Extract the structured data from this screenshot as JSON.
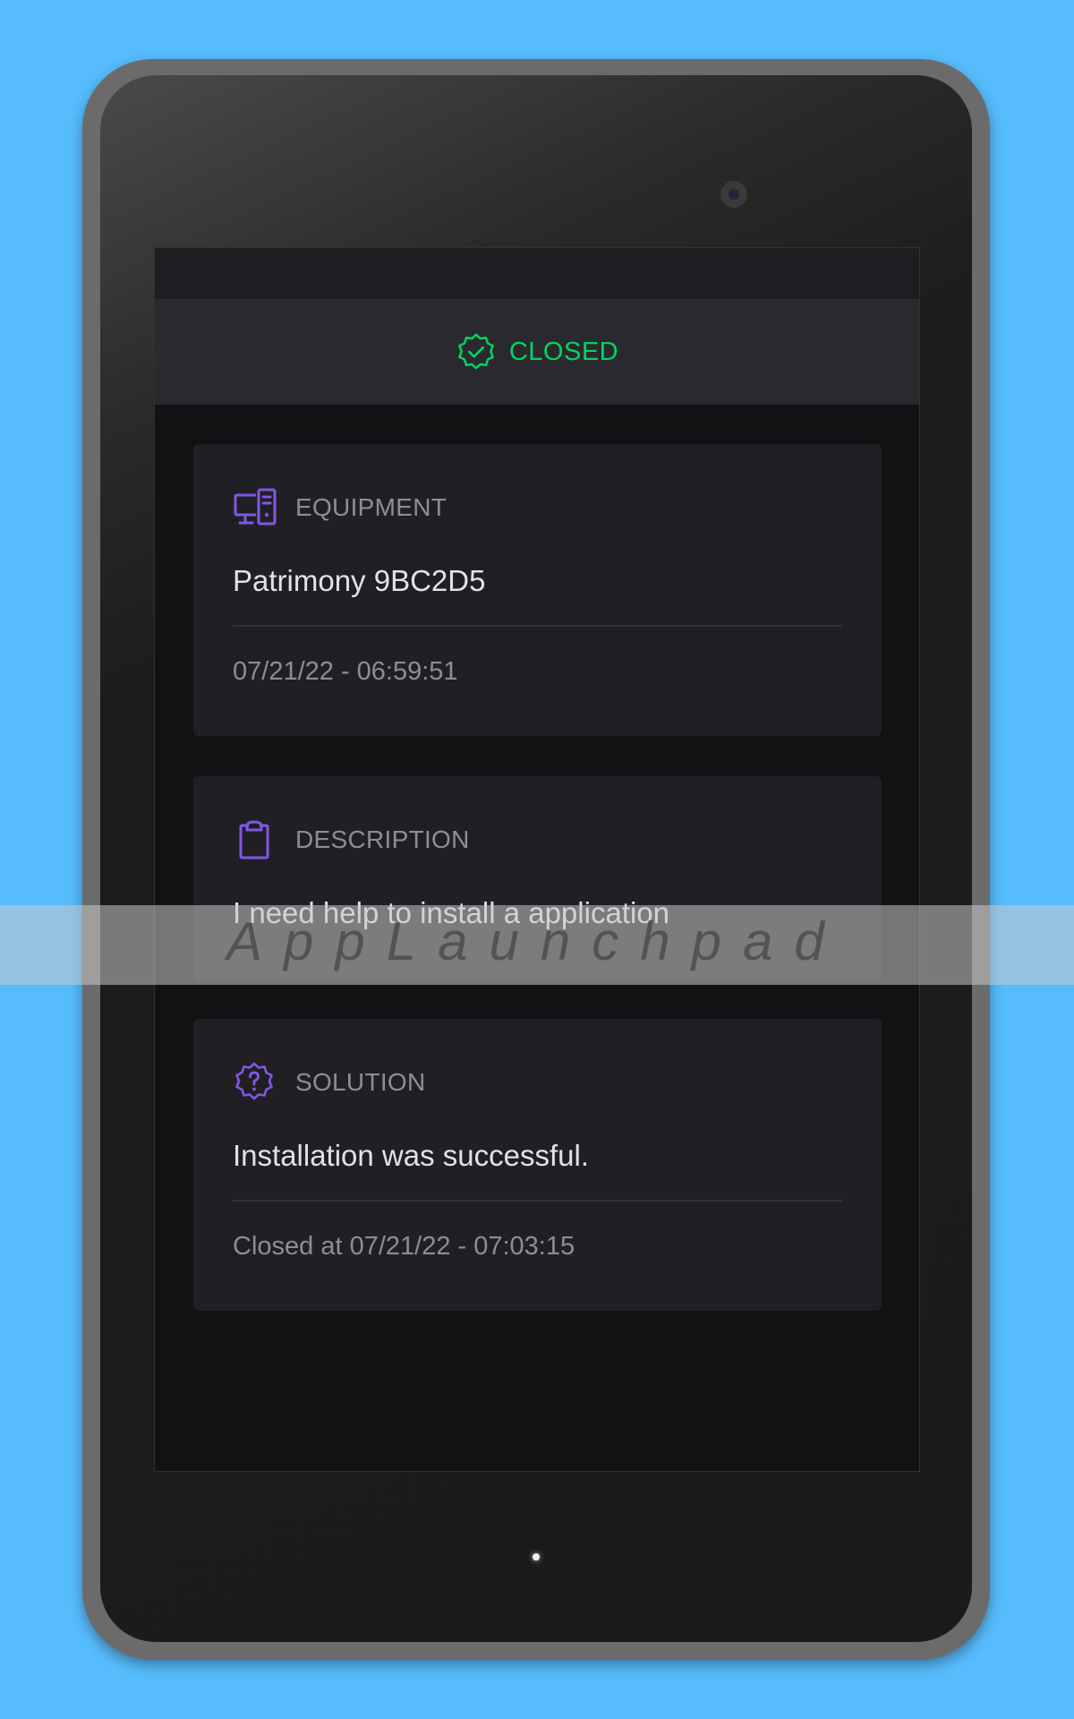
{
  "header": {
    "status": "CLOSED",
    "icon": "seal-check-icon"
  },
  "cards": {
    "equipment": {
      "icon": "desktop-tower-icon",
      "title": "EQUIPMENT",
      "value": "Patrimony 9BC2D5",
      "footer": "07/21/22 - 06:59:51"
    },
    "description": {
      "icon": "clipboard-icon",
      "title": "DESCRIPTION",
      "value": "I need help to install a application"
    },
    "solution": {
      "icon": "seal-question-icon",
      "title": "SOLUTION",
      "value": "Installation was successful.",
      "footer": "Closed at 07/21/22 - 07:03:15"
    }
  },
  "watermark": {
    "text": "AppLaunchpad"
  },
  "colors": {
    "background": "#56bcfc",
    "status_closed": "#04d361",
    "accent_icon": "#8257e5",
    "card": "#202024",
    "screen": "#121214"
  }
}
